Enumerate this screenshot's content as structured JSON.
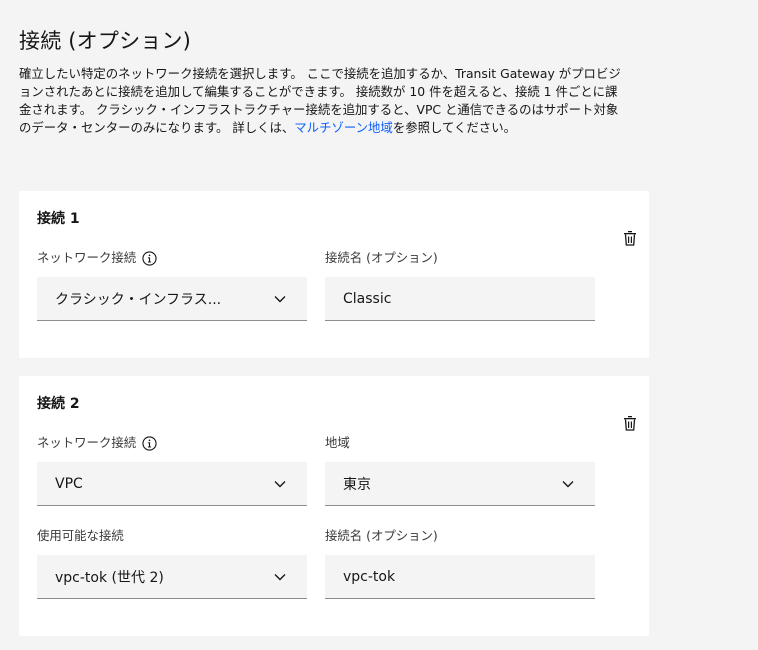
{
  "section": {
    "title": "接続 (オプション)",
    "description_parts": [
      "確立したい特定のネットワーク接続を選択します。 ここで接続を追加するか、Transit Gateway がプロビジョンされたあとに接続を追加して編集することができます。 接続数が 10 件を超えると、接続 1 件ごとに課金されます。 クラシック・インフラストラクチャー接続を追加すると、VPC と通信できるのはサポート対象のデータ・センターのみになります。 詳しくは、",
      "マルチゾーン地域",
      "を参照してください。"
    ]
  },
  "connections": [
    {
      "title": "接続 1",
      "network_label": "ネットワーク接続",
      "network_value": "クラシック・インフラス...",
      "name_label": "接続名 (オプション)",
      "name_value": "Classic"
    },
    {
      "title": "接続 2",
      "network_label": "ネットワーク接続",
      "network_value": "VPC",
      "region_label": "地域",
      "region_value": "東京",
      "available_label": "使用可能な接続",
      "available_value": "vpc-tok (世代 2)",
      "name_label": "接続名 (オプション)",
      "name_value": "vpc-tok"
    }
  ],
  "icons": {
    "info": "info-icon",
    "delete": "trash-icon",
    "dropdown": "chevron-down-icon"
  },
  "colors": {
    "link": "#0f62fe",
    "page_bg": "#f4f4f4",
    "card_bg": "#ffffff",
    "field_bg": "#f4f4f4",
    "field_border": "#8d8d8d"
  }
}
